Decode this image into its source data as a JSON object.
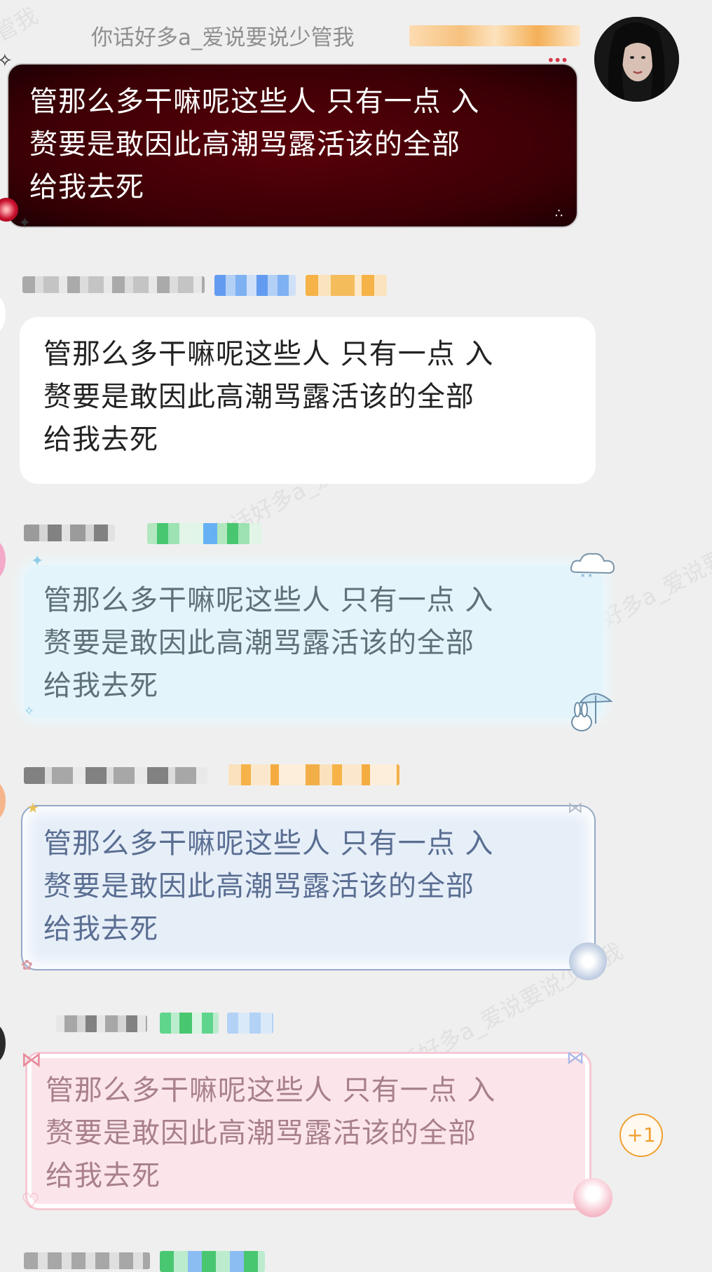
{
  "top_message": {
    "sender_name": "你话好多a_爱说要说少管我",
    "text": "管那么多干嘛呢这些人 只有一点 入\n赘要是敢因此高潮骂露活该的全部\n给我去死"
  },
  "messages": [
    {
      "text": "管那么多干嘛呢这些人 只有一点 入\n赘要是敢因此高潮骂露活该的全部\n给我去死"
    },
    {
      "text": "管那么多干嘛呢这些人 只有一点 入\n赘要是敢因此高潮骂露活该的全部\n给我去死"
    },
    {
      "text": "管那么多干嘛呢这些人 只有一点 入\n赘要是敢因此高潮骂露活该的全部\n给我去死"
    },
    {
      "text": "管那么多干嘛呢这些人 只有一点 入\n赘要是敢因此高潮骂露活该的全部\n给我去死"
    }
  ],
  "plus_one": {
    "label": "+1",
    "color": "#f0a030"
  },
  "watermarks": [
    "你话好多a_爱说要说少管我"
  ],
  "bubble_themes": {
    "dark": "#4a0008",
    "white": "#ffffff",
    "light_blue": "#e3f4fb",
    "blue_frame": "#e6eef8",
    "pink": "#fbe5ea"
  },
  "icons": [
    "profile-avatar",
    "sparkle-icon",
    "flower-icon",
    "cloud-icon",
    "umbrella-bunny-icon",
    "bow-icon",
    "heart-icon",
    "doll-icon"
  ]
}
